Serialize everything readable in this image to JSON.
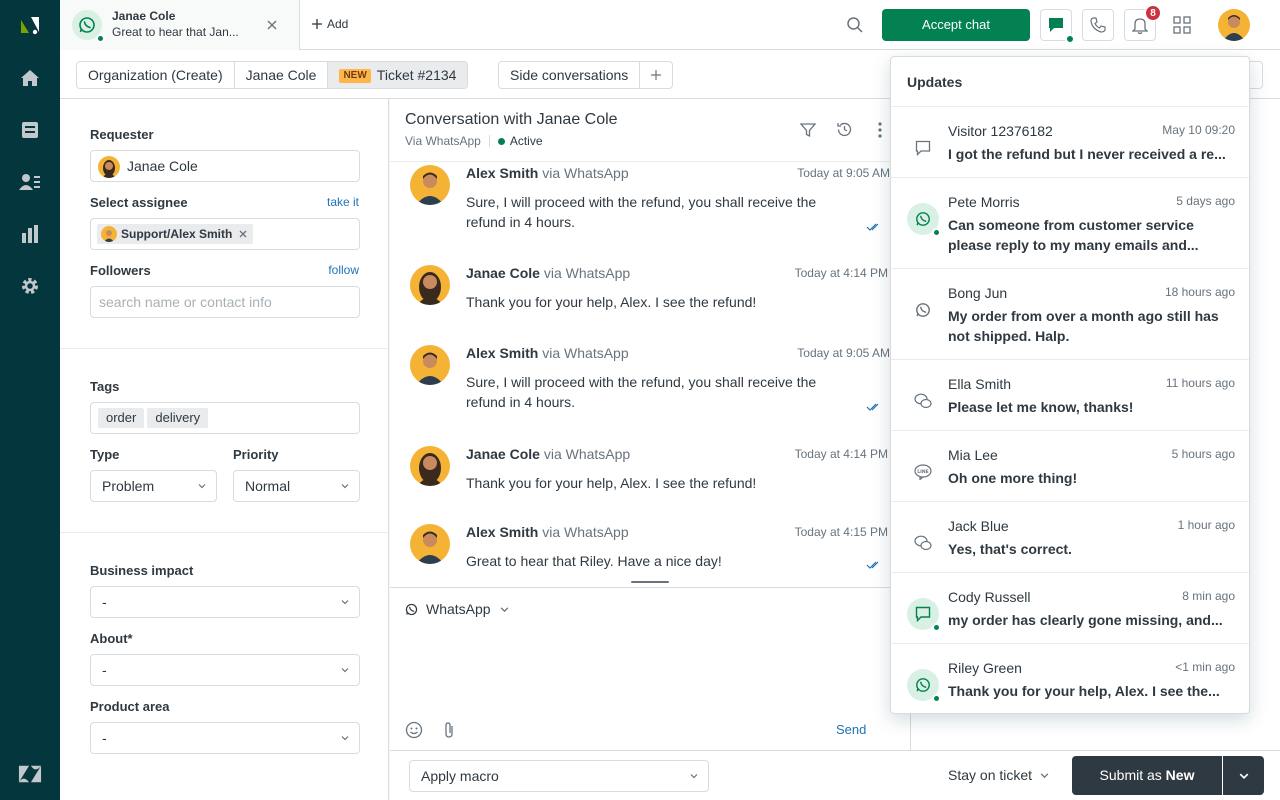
{
  "topbar": {
    "tab_name": "Janae Cole",
    "tab_preview": "Great to hear that Jan...",
    "add_label": "Add",
    "accept_chat_label": "Accept chat",
    "notification_count": "8"
  },
  "subbar": {
    "crumbs": [
      "Organization (Create)",
      "Janae Cole",
      "Ticket #2134",
      "Side conversations"
    ],
    "new_badge": "NEW"
  },
  "sidebar": {
    "requester_label": "Requester",
    "requester_value": "Janae Cole",
    "assignee_label": "Select assignee",
    "take_it": "take it",
    "assignee_value": "Support/Alex Smith",
    "followers_label": "Followers",
    "follow": "follow",
    "followers_placeholder": "search name or contact info",
    "tags_label": "Tags",
    "tags": [
      "order",
      "delivery"
    ],
    "type_label": "Type",
    "type_value": "Problem",
    "priority_label": "Priority",
    "priority_value": "Normal",
    "business_impact_label": "Business impact",
    "business_impact_value": "-",
    "about_label": "About*",
    "about_value": "-",
    "product_area_label": "Product area",
    "product_area_value": "-"
  },
  "conversation": {
    "title": "Conversation with Janae Cole",
    "via": "Via WhatsApp",
    "status": "Active",
    "messages": [
      {
        "name": "Alex Smith",
        "via": "via WhatsApp",
        "time": "Today at 9:05 AM",
        "text": "Sure, I will proceed with the refund, you shall receive the refund in 4 hours."
      },
      {
        "name": "Janae Cole",
        "via": "via WhatsApp",
        "time": "Today at 4:14 PM",
        "text": "Thank you for your help, Alex. I see the refund!"
      },
      {
        "name": "Alex Smith",
        "via": "via WhatsApp",
        "time": "Today at 9:05 AM",
        "text": "Sure, I will proceed with the refund, you shall receive the refund in 4 hours."
      },
      {
        "name": "Janae Cole",
        "via": "via WhatsApp",
        "time": "Today at 4:14 PM",
        "text": "Thank you for your help, Alex. I see the refund!"
      },
      {
        "name": "Alex Smith",
        "via": "via WhatsApp",
        "time": "Today at 4:15 PM",
        "text": "Great to hear that Riley. Have a nice day!"
      }
    ]
  },
  "composer": {
    "channel": "WhatsApp",
    "send_label": "Send"
  },
  "footer": {
    "apply_macro": "Apply macro",
    "stay_on_ticket": "Stay on ticket",
    "submit_prefix": "Submit as",
    "submit_status": "New"
  },
  "updates": {
    "title": "Updates",
    "items": [
      {
        "name": "Visitor 12376182",
        "time": "May 10 09:20",
        "text": "I got the refund but I never received a re...",
        "icon": "chat-bubble-icon"
      },
      {
        "name": "Pete Morris",
        "time": "5 days ago",
        "text": "Can someone from customer service please reply to my many emails and...",
        "icon": "whatsapp-icon"
      },
      {
        "name": "Bong Jun",
        "time": "18 hours ago",
        "text": "My order from over a month ago still has not shipped. Halp.",
        "icon": "whatsapp-icon"
      },
      {
        "name": "Ella Smith",
        "time": "11 hours ago",
        "text": "Please let me know, thanks!",
        "icon": "wechat-icon"
      },
      {
        "name": "Mia Lee",
        "time": "5 hours ago",
        "text": "Oh one more thing!",
        "icon": "line-icon"
      },
      {
        "name": "Jack Blue",
        "time": "1 hour ago",
        "text": "Yes, that's correct.",
        "icon": "wechat-icon"
      },
      {
        "name": "Cody Russell",
        "time": "8 min ago",
        "text": "my order has clearly gone missing, and...",
        "icon": "chat-bubble-icon"
      },
      {
        "name": "Riley Green",
        "time": "<1 min ago",
        "text": "Thank you for your help, Alex. I see the...",
        "icon": "whatsapp-icon"
      }
    ]
  }
}
